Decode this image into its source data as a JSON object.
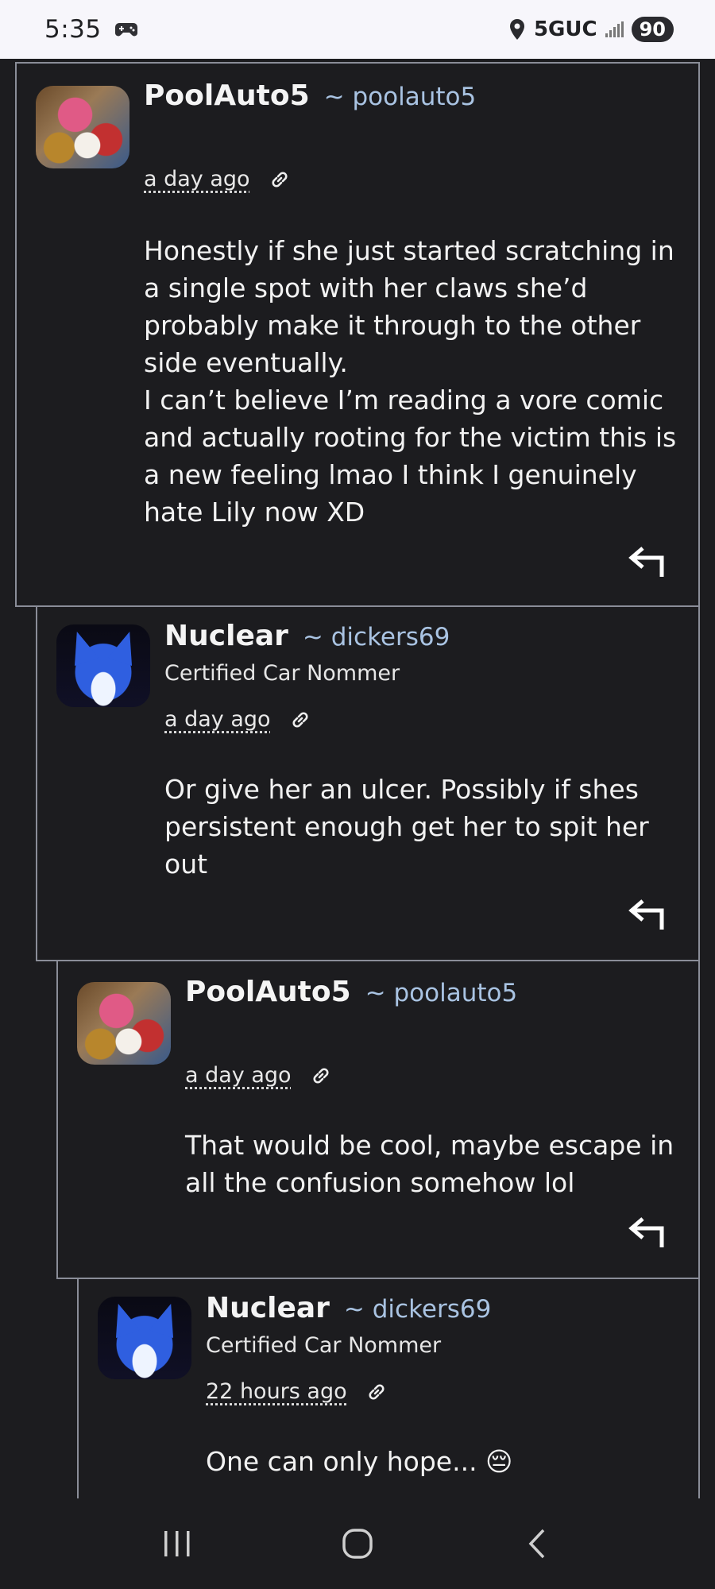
{
  "status_bar": {
    "time": "5:35",
    "network": "5GUC",
    "battery": "90"
  },
  "comments": [
    {
      "display_name": "PoolAuto5",
      "handle": "~ poolauto5",
      "tagline": "",
      "time": "a day ago",
      "body": "Honestly if she just started scratching in\na single spot with her claws she’d\nprobably make it through to the other\nside eventually.\nI can’t believe I’m reading a vore comic\nand actually rooting for the victim this is\na new feeling lmao I think I genuinely\nhate Lily now XD",
      "avatar": "pool-avatar"
    },
    {
      "display_name": "Nuclear",
      "handle": "~ dickers69",
      "tagline": "Certified Car Nommer",
      "time": "a day ago",
      "body": "Or give her an ulcer. Possibly if shes\npersistent enough get her to spit her\nout",
      "avatar": "nuclear-avatar"
    },
    {
      "display_name": "PoolAuto5",
      "handle": "~ poolauto5",
      "tagline": "",
      "time": "a day ago",
      "body": "That would be cool, maybe escape in\nall the confusion somehow lol",
      "avatar": "pool-avatar"
    },
    {
      "display_name": "Nuclear",
      "handle": "~ dickers69",
      "tagline": "Certified Car Nommer",
      "time": "22 hours ago",
      "body": "One can only hope... 😔",
      "avatar": "nuclear-avatar"
    }
  ],
  "icons": {
    "link": "link-icon",
    "reply": "reply-arrow-icon",
    "nav_recents": "recents-icon",
    "nav_home": "home-icon",
    "nav_back": "back-icon"
  },
  "colors": {
    "background": "#1c1c1f",
    "border": "#8a8d98",
    "handle": "#a9c3e2",
    "status_bar": "#f7f6fb"
  }
}
